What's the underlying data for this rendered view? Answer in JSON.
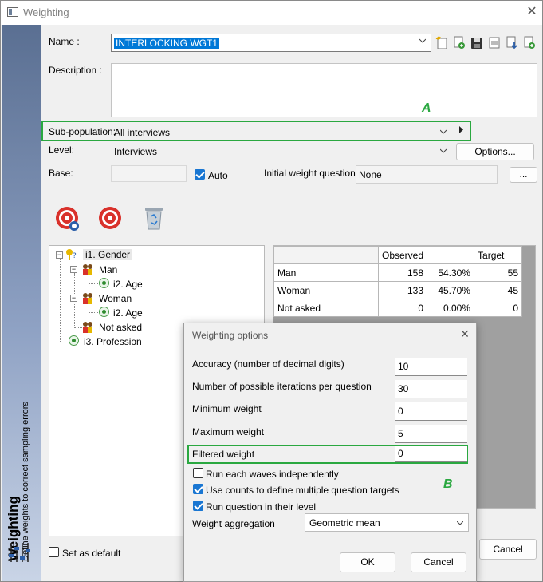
{
  "window": {
    "title": "Weighting"
  },
  "sidebar": {
    "title": "Weighting",
    "subtitle": "Define weights to correct sampling errors"
  },
  "form": {
    "name_label": "Name :",
    "name_value": "INTERLOCKING WGT1",
    "description_label": "Description :",
    "subpop_label": "Sub-population:",
    "subpop_value": "All interviews",
    "level_label": "Level:",
    "level_value": "Interviews",
    "options_button": "Options...",
    "base_label": "Base:",
    "auto_label": "Auto",
    "initial_weight_label": "Initial weight question:",
    "initial_weight_value": "None",
    "ellipsis_button": "...",
    "set_default_label": "Set as default",
    "cancel_button": "Cancel"
  },
  "annotations": {
    "a": "A",
    "b": "B"
  },
  "tree": {
    "items": [
      {
        "label": "i1. Gender"
      },
      {
        "label": "Man"
      },
      {
        "label": "i2. Age"
      },
      {
        "label": "Woman"
      },
      {
        "label": "i2. Age"
      },
      {
        "label": "Not asked"
      },
      {
        "label": "i3. Profession"
      }
    ]
  },
  "grid": {
    "headers": [
      "",
      "Observed",
      "",
      "Target"
    ],
    "rows": [
      {
        "label": "Man",
        "observed": "158",
        "pct": "54.30%",
        "target": "55"
      },
      {
        "label": "Woman",
        "observed": "133",
        "pct": "45.70%",
        "target": "45"
      },
      {
        "label": "Not asked",
        "observed": "0",
        "pct": "0.00%",
        "target": "0"
      }
    ]
  },
  "dialog": {
    "title": "Weighting options",
    "fields": [
      {
        "label": "Accuracy (number of decimal digits)",
        "value": "10"
      },
      {
        "label": "Number of possible iterations per question",
        "value": "30"
      },
      {
        "label": "Minimum weight",
        "value": "0"
      },
      {
        "label": "Maximum weight",
        "value": "5"
      },
      {
        "label": "Filtered weight",
        "value": "0"
      }
    ],
    "checks": [
      {
        "label": "Run each waves independently",
        "checked": false
      },
      {
        "label": "Use counts to define multiple question targets",
        "checked": true
      },
      {
        "label": "Run question in their level",
        "checked": true
      }
    ],
    "aggregation_label": "Weight aggregation",
    "aggregation_value": "Geometric mean",
    "ok_button": "OK",
    "cancel_button": "Cancel"
  },
  "colors": {
    "accent": "#1976d2",
    "annotation": "#2aa840",
    "selection": "#0078d7"
  }
}
